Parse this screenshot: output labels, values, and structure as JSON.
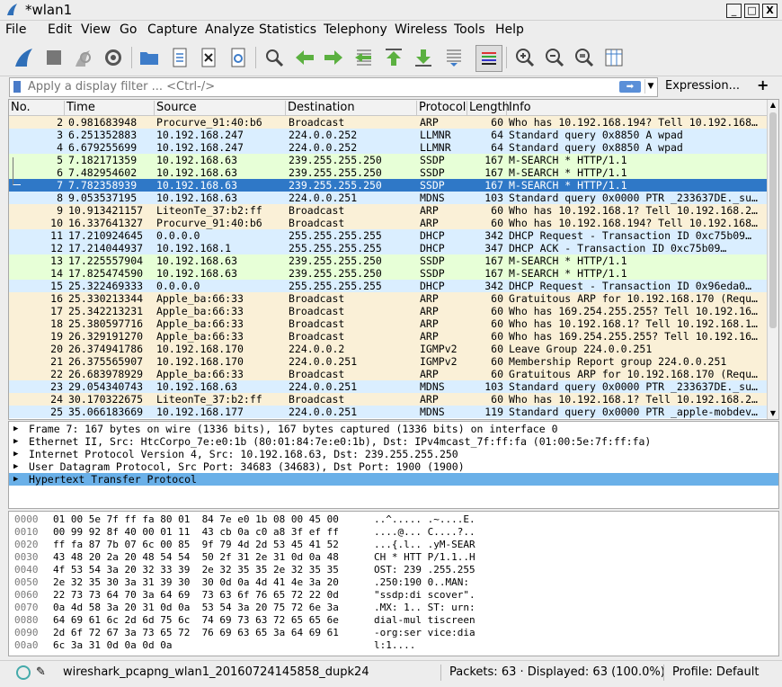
{
  "window": {
    "title": "*wlan1",
    "min_icon": "_",
    "max_icon": "□",
    "close_icon": "X"
  },
  "menu": [
    "File",
    "Edit",
    "View",
    "Go",
    "Capture",
    "Analyze",
    "Statistics",
    "Telephony",
    "Wireless",
    "Tools",
    "Help"
  ],
  "filter": {
    "placeholder": "Apply a display filter ... <Ctrl-/>",
    "expression_label": "Expression...",
    "plus_label": "+"
  },
  "columns": [
    "No.",
    "Time",
    "Source",
    "Destination",
    "Protocol",
    "Length",
    "Info"
  ],
  "colors": {
    "arp": "#faf0d7",
    "udp": "#daeeff",
    "ssdp": "#e7ffd7",
    "selected": "#2f78c7",
    "dhcp": "#daeeff",
    "igmp": "#faf0d7",
    "mdns": "#daeeff"
  },
  "packets": [
    {
      "no": "2",
      "time": "0.981683948",
      "src": "Procurve_91:40:b6",
      "dst": "Broadcast",
      "proto": "ARP",
      "len": "60",
      "info": "Who has 10.192.168.194? Tell 10.192.168…",
      "color": "arp"
    },
    {
      "no": "3",
      "time": "6.251352883",
      "src": "10.192.168.247",
      "dst": "224.0.0.252",
      "proto": "LLMNR",
      "len": "64",
      "info": "Standard query 0x8850 A wpad",
      "color": "udp"
    },
    {
      "no": "4",
      "time": "6.679255699",
      "src": "10.192.168.247",
      "dst": "224.0.0.252",
      "proto": "LLMNR",
      "len": "64",
      "info": "Standard query 0x8850 A wpad",
      "color": "udp"
    },
    {
      "no": "5",
      "time": "7.182171359",
      "src": "10.192.168.63",
      "dst": "239.255.255.250",
      "proto": "SSDP",
      "len": "167",
      "info": "M-SEARCH * HTTP/1.1",
      "color": "ssdp"
    },
    {
      "no": "6",
      "time": "7.482954602",
      "src": "10.192.168.63",
      "dst": "239.255.255.250",
      "proto": "SSDP",
      "len": "167",
      "info": "M-SEARCH * HTTP/1.1",
      "color": "ssdp"
    },
    {
      "no": "7",
      "time": "7.782358939",
      "src": "10.192.168.63",
      "dst": "239.255.255.250",
      "proto": "SSDP",
      "len": "167",
      "info": "M-SEARCH * HTTP/1.1",
      "color": "selected"
    },
    {
      "no": "8",
      "time": "9.053537195",
      "src": "10.192.168.63",
      "dst": "224.0.0.251",
      "proto": "MDNS",
      "len": "103",
      "info": "Standard query 0x0000 PTR _233637DE._su…",
      "color": "mdns"
    },
    {
      "no": "9",
      "time": "10.913421157",
      "src": "LiteonTe_37:b2:ff",
      "dst": "Broadcast",
      "proto": "ARP",
      "len": "60",
      "info": "Who has 10.192.168.1? Tell 10.192.168.2…",
      "color": "arp"
    },
    {
      "no": "10",
      "time": "16.337641327",
      "src": "Procurve_91:40:b6",
      "dst": "Broadcast",
      "proto": "ARP",
      "len": "60",
      "info": "Who has 10.192.168.194? Tell 10.192.168…",
      "color": "arp"
    },
    {
      "no": "11",
      "time": "17.210924645",
      "src": "0.0.0.0",
      "dst": "255.255.255.255",
      "proto": "DHCP",
      "len": "342",
      "info": "DHCP Request  - Transaction ID 0xc75b09…",
      "color": "dhcp"
    },
    {
      "no": "12",
      "time": "17.214044937",
      "src": "10.192.168.1",
      "dst": "255.255.255.255",
      "proto": "DHCP",
      "len": "347",
      "info": "DHCP ACK      - Transaction ID 0xc75b09…",
      "color": "dhcp"
    },
    {
      "no": "13",
      "time": "17.225557904",
      "src": "10.192.168.63",
      "dst": "239.255.255.250",
      "proto": "SSDP",
      "len": "167",
      "info": "M-SEARCH * HTTP/1.1",
      "color": "ssdp"
    },
    {
      "no": "14",
      "time": "17.825474590",
      "src": "10.192.168.63",
      "dst": "239.255.255.250",
      "proto": "SSDP",
      "len": "167",
      "info": "M-SEARCH * HTTP/1.1",
      "color": "ssdp"
    },
    {
      "no": "15",
      "time": "25.322469333",
      "src": "0.0.0.0",
      "dst": "255.255.255.255",
      "proto": "DHCP",
      "len": "342",
      "info": "DHCP Request  - Transaction ID 0x96eda0…",
      "color": "dhcp"
    },
    {
      "no": "16",
      "time": "25.330213344",
      "src": "Apple_ba:66:33",
      "dst": "Broadcast",
      "proto": "ARP",
      "len": "60",
      "info": "Gratuitous ARP for 10.192.168.170 (Requ…",
      "color": "arp"
    },
    {
      "no": "17",
      "time": "25.342213231",
      "src": "Apple_ba:66:33",
      "dst": "Broadcast",
      "proto": "ARP",
      "len": "60",
      "info": "Who has 169.254.255.255? Tell 10.192.16…",
      "color": "arp"
    },
    {
      "no": "18",
      "time": "25.380597716",
      "src": "Apple_ba:66:33",
      "dst": "Broadcast",
      "proto": "ARP",
      "len": "60",
      "info": "Who has 10.192.168.1? Tell 10.192.168.1…",
      "color": "arp"
    },
    {
      "no": "19",
      "time": "26.329191270",
      "src": "Apple_ba:66:33",
      "dst": "Broadcast",
      "proto": "ARP",
      "len": "60",
      "info": "Who has 169.254.255.255? Tell 10.192.16…",
      "color": "arp"
    },
    {
      "no": "20",
      "time": "26.374941786",
      "src": "10.192.168.170",
      "dst": "224.0.0.2",
      "proto": "IGMPv2",
      "len": "60",
      "info": "Leave Group 224.0.0.251",
      "color": "igmp"
    },
    {
      "no": "21",
      "time": "26.375565907",
      "src": "10.192.168.170",
      "dst": "224.0.0.251",
      "proto": "IGMPv2",
      "len": "60",
      "info": "Membership Report group 224.0.0.251",
      "color": "igmp"
    },
    {
      "no": "22",
      "time": "26.683978929",
      "src": "Apple_ba:66:33",
      "dst": "Broadcast",
      "proto": "ARP",
      "len": "60",
      "info": "Gratuitous ARP for 10.192.168.170 (Requ…",
      "color": "arp"
    },
    {
      "no": "23",
      "time": "29.054340743",
      "src": "10.192.168.63",
      "dst": "224.0.0.251",
      "proto": "MDNS",
      "len": "103",
      "info": "Standard query 0x0000 PTR _233637DE._su…",
      "color": "mdns"
    },
    {
      "no": "24",
      "time": "30.170322675",
      "src": "LiteonTe_37:b2:ff",
      "dst": "Broadcast",
      "proto": "ARP",
      "len": "60",
      "info": "Who has 10.192.168.1? Tell 10.192.168.2…",
      "color": "arp"
    },
    {
      "no": "25",
      "time": "35.066183669",
      "src": "10.192.168.177",
      "dst": "224.0.0.251",
      "proto": "MDNS",
      "len": "119",
      "info": "Standard query 0x0000 PTR _apple-mobdev…",
      "color": "mdns"
    }
  ],
  "details": [
    {
      "text": "Frame 7: 167 bytes on wire (1336 bits), 167 bytes captured (1336 bits) on interface 0",
      "selected": false
    },
    {
      "text": "Ethernet II, Src: HtcCorpo_7e:e0:1b (80:01:84:7e:e0:1b), Dst: IPv4mcast_7f:ff:fa (01:00:5e:7f:ff:fa)",
      "selected": false
    },
    {
      "text": "Internet Protocol Version 4, Src: 10.192.168.63, Dst: 239.255.255.250",
      "selected": false
    },
    {
      "text": "User Datagram Protocol, Src Port: 34683 (34683), Dst Port: 1900 (1900)",
      "selected": false
    },
    {
      "text": "Hypertext Transfer Protocol",
      "selected": true
    }
  ],
  "bytes": [
    {
      "off": "0000",
      "hex": "01 00 5e 7f ff fa 80 01  84 7e e0 1b 08 00 45 00",
      "asc": "..^..... .~....E."
    },
    {
      "off": "0010",
      "hex": "00 99 92 8f 40 00 01 11  43 cb 0a c0 a8 3f ef ff",
      "asc": "....@... C....?.."
    },
    {
      "off": "0020",
      "hex": "ff fa 87 7b 07 6c 00 85  9f 79 4d 2d 53 45 41 52",
      "asc": "...{.l.. .yM-SEAR"
    },
    {
      "off": "0030",
      "hex": "43 48 20 2a 20 48 54 54  50 2f 31 2e 31 0d 0a 48",
      "asc": "CH * HTT P/1.1..H"
    },
    {
      "off": "0040",
      "hex": "4f 53 54 3a 20 32 33 39  2e 32 35 35 2e 32 35 35",
      "asc": "OST: 239 .255.255"
    },
    {
      "off": "0050",
      "hex": "2e 32 35 30 3a 31 39 30  30 0d 0a 4d 41 4e 3a 20",
      "asc": ".250:190 0..MAN: "
    },
    {
      "off": "0060",
      "hex": "22 73 73 64 70 3a 64 69  73 63 6f 76 65 72 22 0d",
      "asc": "\"ssdp:di scover\"."
    },
    {
      "off": "0070",
      "hex": "0a 4d 58 3a 20 31 0d 0a  53 54 3a 20 75 72 6e 3a",
      "asc": ".MX: 1.. ST: urn:"
    },
    {
      "off": "0080",
      "hex": "64 69 61 6c 2d 6d 75 6c  74 69 73 63 72 65 65 6e",
      "asc": "dial-mul tiscreen"
    },
    {
      "off": "0090",
      "hex": "2d 6f 72 67 3a 73 65 72  76 69 63 65 3a 64 69 61",
      "asc": "-org:ser vice:dia"
    },
    {
      "off": "00a0",
      "hex": "6c 3a 31 0d 0a 0d 0a",
      "asc": "l:1...."
    }
  ],
  "status": {
    "filename": "wireshark_pcapng_wlan1_20160724145858_dupk24",
    "packets": "Packets: 63 · Displayed: 63 (100.0%)",
    "profile": "Profile: Default"
  },
  "toolbar_icons": [
    "shark-fin-icon",
    "stop-icon",
    "restart-icon",
    "options-gear-icon",
    "open-folder-icon",
    "save-file-icon",
    "close-file-icon",
    "reload-icon",
    "find-icon",
    "back-arrow-icon",
    "forward-arrow-icon",
    "goto-packet-icon",
    "first-packet-icon",
    "last-packet-icon",
    "autoscroll-icon",
    "colorize-icon",
    "zoom-in-icon",
    "zoom-out-icon",
    "zoom-normal-icon",
    "resize-columns-icon"
  ]
}
